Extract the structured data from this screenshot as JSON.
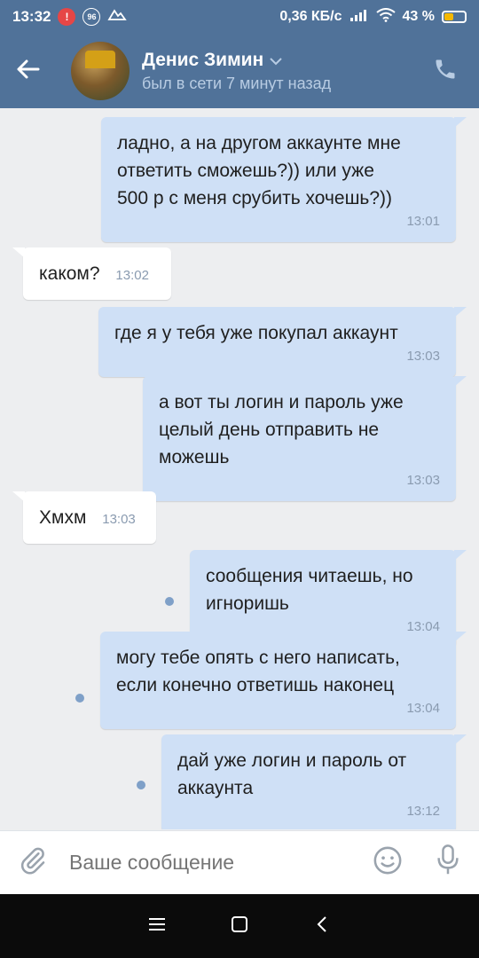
{
  "status_bar": {
    "time": "13:32",
    "notif_count": "96",
    "speed": "0,36 КБ/с",
    "battery": "43 %",
    "battery_level": 0.43
  },
  "header": {
    "name": "Денис Зимин",
    "status": "был в сети 7 минут назад"
  },
  "messages": [
    {
      "dir": "out",
      "text": "ладно, а на другом аккаунте мне\nответить сможешь?)) или уже\n500 р с меня срубить хочешь?))",
      "time": "13:01"
    },
    {
      "dir": "in",
      "text": "каком?",
      "time": "13:02"
    },
    {
      "dir": "out",
      "text": "где я у тебя уже покупал аккаунт",
      "time": "13:03"
    },
    {
      "dir": "out",
      "text": "а вот ты логин и пароль уже\nцелый день отправить не\nможешь",
      "time": "13:03"
    },
    {
      "dir": "in",
      "text": "Хмхм",
      "time": "13:03"
    },
    {
      "dir": "out",
      "text": "сообщения читаешь, но\nигноришь",
      "time": "13:04",
      "unread": true
    },
    {
      "dir": "out",
      "text": "могу тебе опять с него написать,\nесли конечно ответишь наконец",
      "time": "13:04",
      "unread": true
    },
    {
      "dir": "out",
      "text": "дай уже логин и пароль от\nаккаунта",
      "time": "13:12",
      "unread": true
    }
  ],
  "input": {
    "placeholder": "Ваше сообщение"
  },
  "icons": {
    "back": "arrow-left-icon",
    "call": "phone-icon",
    "attach": "paperclip-icon",
    "emoji": "smiley-icon",
    "mic": "microphone-icon"
  },
  "colors": {
    "header_bg": "#507299",
    "outgoing_bubble": "#cfe0f6",
    "incoming_bubble": "#ffffff",
    "chat_bg": "#edeef0"
  }
}
